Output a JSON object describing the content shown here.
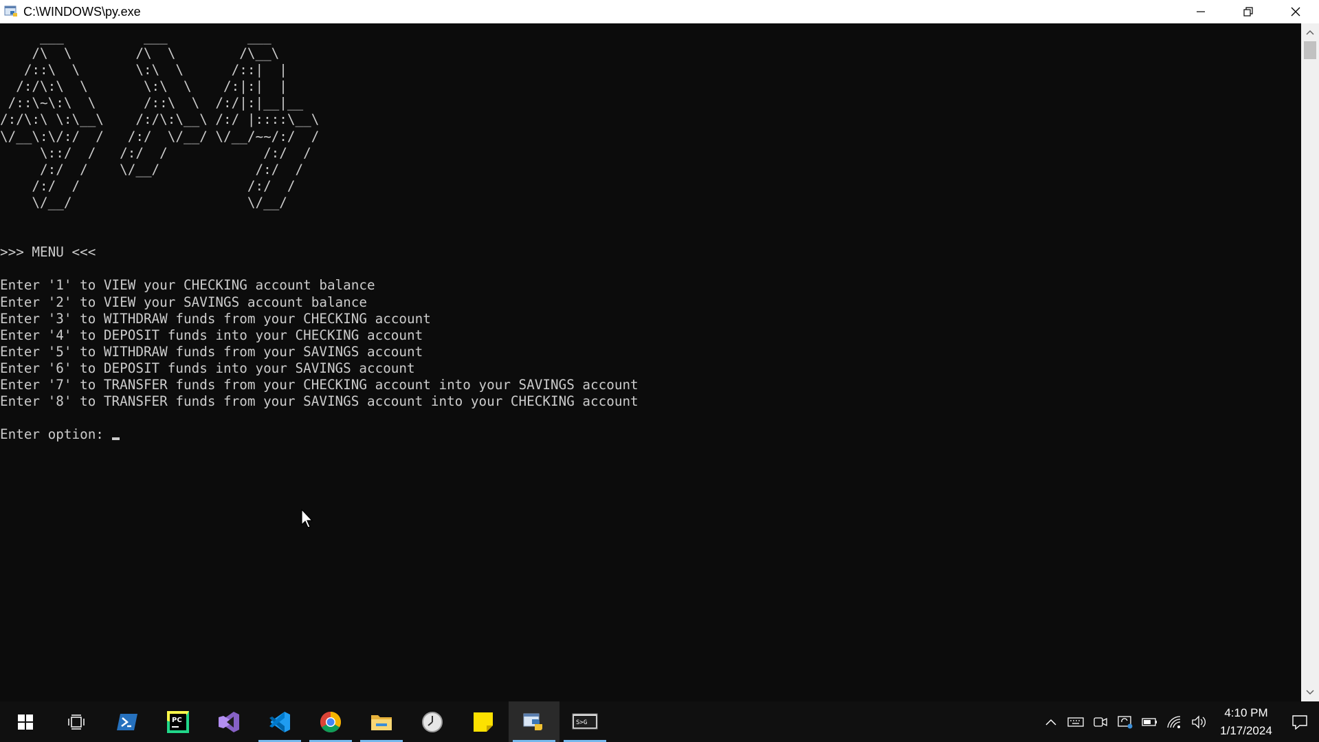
{
  "window": {
    "title": "C:\\WINDOWS\\py.exe"
  },
  "console": {
    "banner_lines": [
      "     ___          ___          ___     ",
      "    /\\  \\        /\\  \\        /\\__\\    ",
      "   /::\\  \\       \\:\\  \\      /::|  |   ",
      "  /:/\\:\\  \\       \\:\\  \\    /:|:|  |   ",
      " /::\\~\\:\\  \\      /::\\  \\  /:/|:|__|__ ",
      "/:/\\:\\ \\:\\__\\    /:/\\:\\__\\ /:/ |::::\\__\\",
      "\\/__\\:\\/:/  /   /:/  \\/__/ \\/__/~~/:/  /",
      "     \\::/  /   /:/  /            /:/  / ",
      "     /:/  /    \\/__/            /:/  /  ",
      "    /:/  /                     /:/  /   ",
      "    \\/__/                      \\/__/    "
    ],
    "menu_header": ">>> MENU <<<",
    "options": [
      "Enter '1' to VIEW your CHECKING account balance",
      "Enter '2' to VIEW your SAVINGS account balance",
      "Enter '3' to WITHDRAW funds from your CHECKING account",
      "Enter '4' to DEPOSIT funds into your CHECKING account",
      "Enter '5' to WITHDRAW funds from your SAVINGS account",
      "Enter '6' to DEPOSIT funds into your SAVINGS account",
      "Enter '7' to TRANSFER funds from your CHECKING account into your SAVINGS account",
      "Enter '8' to TRANSFER funds from your SAVINGS account into your CHECKING account"
    ],
    "prompt": "Enter option: "
  },
  "taskbar": {
    "apps": [
      {
        "name": "start-button",
        "icon": "windows-logo-icon"
      },
      {
        "name": "task-view-button",
        "icon": "task-view-icon"
      },
      {
        "name": "taskbar-powershell",
        "icon": "powershell-icon"
      },
      {
        "name": "taskbar-pycharm",
        "icon": "pycharm-icon"
      },
      {
        "name": "taskbar-visual-studio",
        "icon": "visual-studio-icon"
      },
      {
        "name": "taskbar-vscode",
        "icon": "vscode-icon"
      },
      {
        "name": "taskbar-chrome",
        "icon": "chrome-icon"
      },
      {
        "name": "taskbar-file-explorer",
        "icon": "folder-icon"
      },
      {
        "name": "taskbar-clock-app",
        "icon": "clock-icon"
      },
      {
        "name": "taskbar-sticky-notes",
        "icon": "sticky-notes-icon"
      },
      {
        "name": "taskbar-python",
        "icon": "python-icon"
      },
      {
        "name": "taskbar-terminal",
        "icon": "terminal-icon"
      }
    ],
    "time": "4:10 PM",
    "date": "1/17/2024"
  },
  "colors": {
    "console_bg": "#0c0c0c",
    "console_text": "#cccccc",
    "taskbar_bg": "#101010",
    "accent": "#76b9ed"
  }
}
